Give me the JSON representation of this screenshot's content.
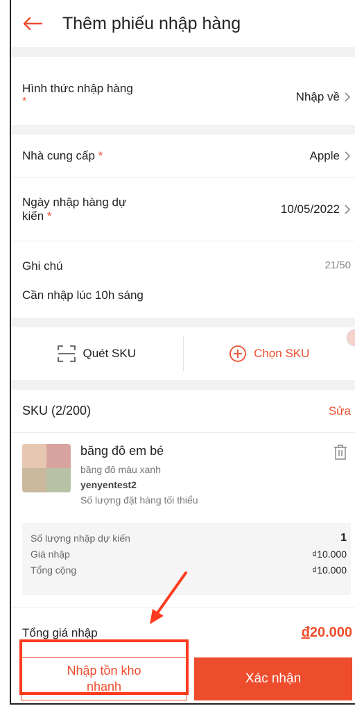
{
  "header": {
    "title": "Thêm phiếu nhập hàng",
    "back_icon": "arrow-left-icon"
  },
  "import_method": {
    "label": "Hình thức nhập hàng",
    "required": "*",
    "value": "Nhập về"
  },
  "supplier": {
    "label": "Nhà cung cấp",
    "required": "*",
    "value": "Apple"
  },
  "expected_date": {
    "label_line1": "Ngày nhập hàng dự",
    "label_line2": "kiến",
    "required": "*",
    "value": "10/05/2022"
  },
  "note": {
    "label": "Ghi chú",
    "counter": "21/50",
    "text": "Cần nhập lúc 10h sáng"
  },
  "actions": {
    "scan_label": "Quét SKU",
    "choose_label": "Chọn SKU"
  },
  "sku": {
    "title": "SKU (2/200)",
    "edit_label": "Sửa",
    "item": {
      "name": "băng đô em bé",
      "variant": "băng đô màu xanh",
      "shop": "yenyentest2",
      "min_qty_text": "Số lượng đặt hàng tối thiểu"
    },
    "summary": {
      "qty_label": "Số lượng nhập dự kiến",
      "qty_value": "1",
      "price_label": "Giá nhập",
      "price_value": "₫10.000",
      "total_label": "Tổng cộng",
      "total_value": "₫10.000"
    }
  },
  "grand_total": {
    "label": "Tổng giá nhập",
    "currency": "đ",
    "amount": "20.000"
  },
  "footer": {
    "quick_line1": "Nhập tồn kho",
    "quick_line2": "nhanh",
    "confirm_label": "Xác nhận"
  },
  "colors": {
    "accent": "#ee4d2d",
    "annotation": "#ff3b1f"
  }
}
